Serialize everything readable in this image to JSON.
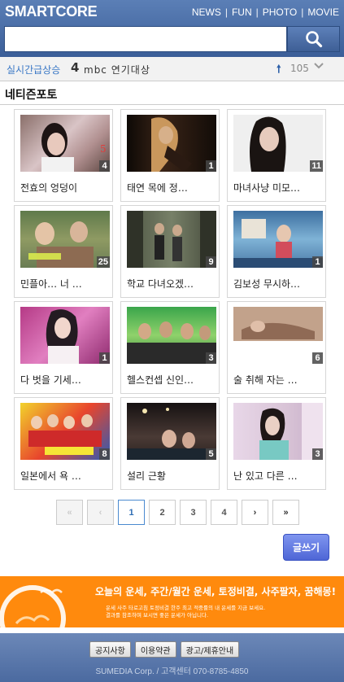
{
  "header": {
    "logo": "SMARTCORE",
    "nav": [
      "NEWS",
      "FUN",
      "PHOTO",
      "MOVIE"
    ]
  },
  "search": {
    "placeholder": "",
    "icon": "search-icon"
  },
  "realtime": {
    "label": "실시간급상승",
    "rank": "4",
    "keyword": "mbc 연기대상",
    "trend_icon": "arrow-up-icon",
    "count": "105",
    "expand_icon": "chevron-down-icon"
  },
  "section": {
    "title": "네티즌포토"
  },
  "cards": [
    {
      "caption": "전효의 엉덩이",
      "count": "4"
    },
    {
      "caption": "태연 목에 정…",
      "count": "1"
    },
    {
      "caption": "마녀사냥 미모…",
      "count": "11"
    },
    {
      "caption": "민플아… 너 …",
      "count": "25"
    },
    {
      "caption": "학교 다녀오겠…",
      "count": "9"
    },
    {
      "caption": "김보성 무시하…",
      "count": "1"
    },
    {
      "caption": "다 벗을 기세…",
      "count": "1"
    },
    {
      "caption": "헬스컨셉 신인…",
      "count": "3"
    },
    {
      "caption": "술 취해 자는 …",
      "count": "6"
    },
    {
      "caption": "일본에서 욕 …",
      "count": "8"
    },
    {
      "caption": "설리 근황",
      "count": "5"
    },
    {
      "caption": "난 있고 다른 …",
      "count": "3"
    }
  ],
  "pagination": {
    "first": "«",
    "prev": "‹",
    "pages": [
      "1",
      "2",
      "3",
      "4"
    ],
    "current": "1",
    "next": "›",
    "last": "»"
  },
  "write_button": "글쓰기",
  "ad": {
    "headline": "오늘의 운세, 주간/월간 운세, 토정비결, 사주팔자, 꿈해몽!",
    "sub1": "운세 사주 타로고침 토정비결 한주 최고 적중률의 내 운세를 지금 보세요.",
    "sub2": "결과를 참조하며 보시면 좋은 운세가 아닙니다."
  },
  "footer": {
    "buttons": [
      "공지사항",
      "이용약관",
      "광고/제휴안내"
    ],
    "copyright": "SUMEDIA Corp. / 고객센터 070-8785-4850"
  },
  "colors": {
    "header": "#4a6ea8",
    "accent": "#3a78c6",
    "ad": "#ff8a0d"
  }
}
